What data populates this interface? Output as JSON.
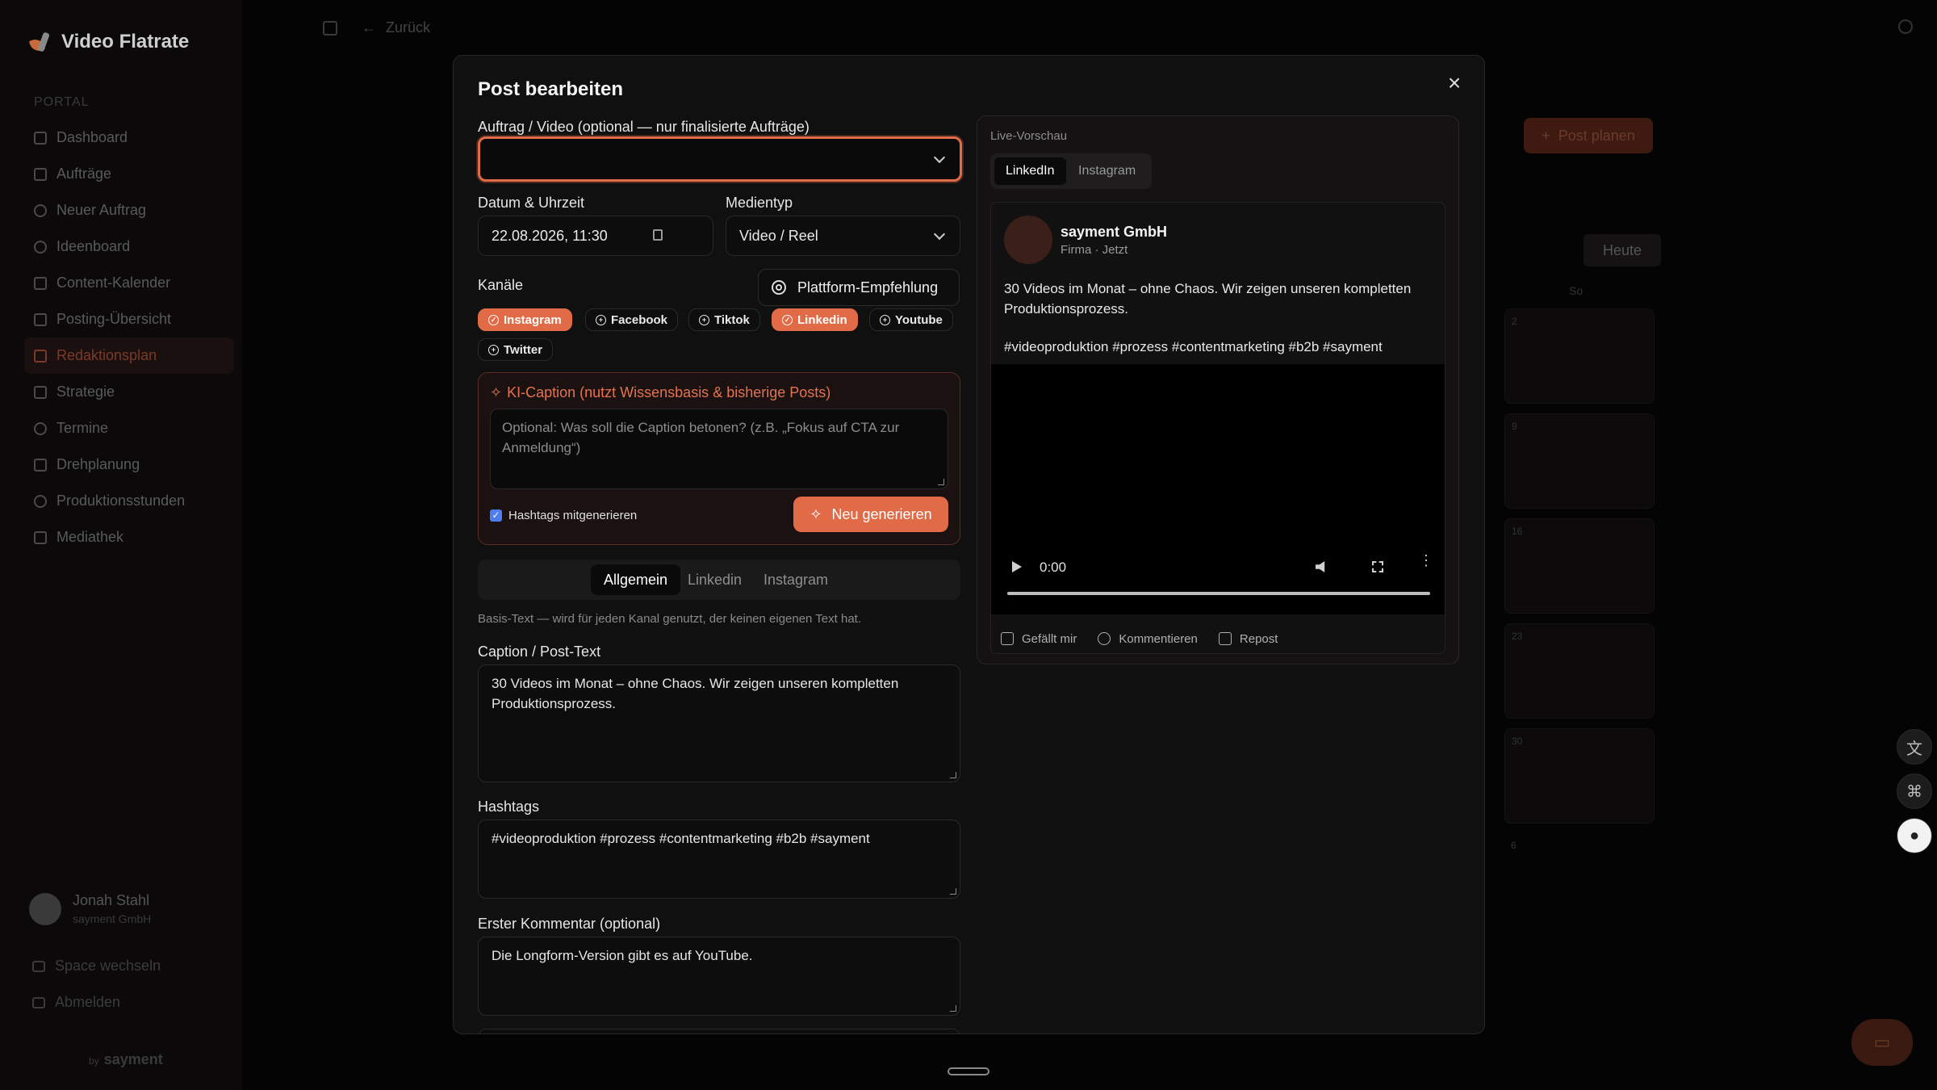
{
  "app": {
    "brand": "Video Flatrate",
    "portal_label": "PORTAL",
    "nav": [
      {
        "label": "Dashboard",
        "icon": "dashboard-icon"
      },
      {
        "label": "Aufträge",
        "icon": "file-icon"
      },
      {
        "label": "Neuer Auftrag",
        "icon": "plus-circle-icon"
      },
      {
        "label": "Ideenboard",
        "icon": "lightbulb-icon"
      },
      {
        "label": "Content-Kalender",
        "icon": "calendar-icon"
      },
      {
        "label": "Posting-Übersicht",
        "icon": "clipboard-icon"
      },
      {
        "label": "Redaktionsplan",
        "icon": "calendar-check-icon",
        "active": true
      },
      {
        "label": "Strategie",
        "icon": "strategy-icon"
      },
      {
        "label": "Termine",
        "icon": "clock-icon"
      },
      {
        "label": "Drehplanung",
        "icon": "clapperboard-icon"
      },
      {
        "label": "Produktionsstunden",
        "icon": "timer-icon"
      },
      {
        "label": "Mediathek",
        "icon": "film-icon"
      }
    ],
    "user": {
      "name": "Jonah Stahl",
      "company": "sayment GmbH"
    },
    "space_switch": "Space wechseln",
    "logout": "Abmelden",
    "powered_by": "by",
    "powered_name": "sayment",
    "back": "Zurück",
    "post_planen": "Post planen",
    "heute": "Heute",
    "weekday_so": "So",
    "calendar_days": [
      "2",
      "9",
      "16",
      "23",
      "30",
      "6"
    ]
  },
  "modal": {
    "title": "Post bearbeiten",
    "auftrag_label": "Auftrag / Video (optional — nur finalisierte Aufträge)",
    "auftrag_value": "",
    "datum_label": "Datum & Uhrzeit",
    "datum_value": "22.08.2026, 11:30",
    "medientyp_label": "Medientyp",
    "medientyp_value": "Video / Reel",
    "kanaele_label": "Kanäle",
    "plattform_button": "Plattform-Empfehlung",
    "channels": [
      {
        "label": "Instagram",
        "selected": true
      },
      {
        "label": "Facebook",
        "selected": false
      },
      {
        "label": "Tiktok",
        "selected": false
      },
      {
        "label": "Linkedin",
        "selected": true
      },
      {
        "label": "Youtube",
        "selected": false
      },
      {
        "label": "Twitter",
        "selected": false
      }
    ],
    "ki": {
      "title": "KI-Caption (nutzt Wissensbasis & bisherige Posts)",
      "placeholder": "Optional: Was soll die Caption betonen? (z.B. „Fokus auf CTA zur Anmeldung“)",
      "hashtags_check": "Hashtags mitgenerieren",
      "generate": "Neu generieren"
    },
    "tabs": [
      "Allgemein",
      "Linkedin",
      "Instagram"
    ],
    "hint": "Basis-Text — wird für jeden Kanal genutzt, der keinen eigenen Text hat.",
    "caption_label": "Caption / Post-Text",
    "caption_value": "30 Videos im Monat – ohne Chaos. Wir zeigen unseren kompletten Produktionsprozess.",
    "hashtags_label": "Hashtags",
    "hashtags_value": "#videoproduktion #prozess #contentmarketing #b2b #sayment",
    "comment_label": "Erster Kommentar (optional)",
    "comment_value": "Die Longform-Version gibt es auf YouTube."
  },
  "preview": {
    "label": "Live-Vorschau",
    "tabs": [
      "LinkedIn",
      "Instagram"
    ],
    "company": "sayment GmbH",
    "sub": "Firma · Jetzt",
    "text": "30 Videos im Monat – ohne Chaos. Wir zeigen unseren kompletten Produktionsprozess.",
    "tags": "#videoproduktion #prozess #contentmarketing #b2b #sayment",
    "video_time": "0:00",
    "actions": [
      "Gefällt mir",
      "Kommentieren",
      "Repost"
    ]
  },
  "colors": {
    "accent": "#e26b47",
    "checkbox": "#4d7df0"
  }
}
